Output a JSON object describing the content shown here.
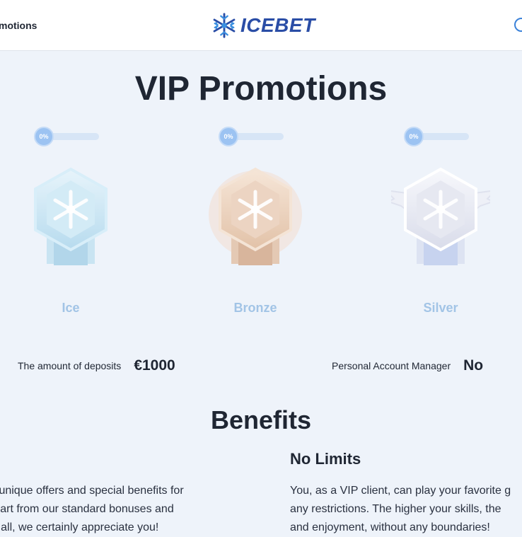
{
  "header": {
    "nav_label": "motions",
    "logo_text": "ICEBET"
  },
  "page": {
    "title": "VIP Promotions"
  },
  "tiers": [
    {
      "name": "Ice",
      "progress_label": "0%",
      "progress": 0,
      "color": "#a2c4e6"
    },
    {
      "name": "Bronze",
      "progress_label": "0%",
      "progress": 0,
      "color": "#a2c4e6"
    },
    {
      "name": "Silver",
      "progress_label": "0%",
      "progress": 0,
      "color": "#a2c4e6"
    }
  ],
  "stats": {
    "deposits_label": "The amount of deposits",
    "deposits_value": "€1000",
    "manager_label": "Personal Account Manager",
    "manager_value": "No"
  },
  "benefits": {
    "title": "Benefits",
    "items": [
      {
        "title": "",
        "lines": [
          "ys unique offers and special benefits for",
          " apart from our standard bonuses and",
          "ter all, we certainly appreciate you!"
        ]
      },
      {
        "title": "No Limits",
        "lines": [
          "You, as a VIP client, can play your favorite g",
          "any restrictions. The higher your skills, the",
          "and enjoyment, without any boundaries!"
        ]
      }
    ]
  },
  "colors": {
    "accent": "#3b82d9",
    "brand": "#2a4da6",
    "background": "#eef3fa",
    "text": "#1f2633"
  },
  "icons": {
    "logo": "snowflake-logo-icon",
    "header_right": "circle-icon",
    "badge_ice": "ice-snowflake-badge-icon",
    "badge_bronze": "bronze-snowflake-badge-icon",
    "badge_silver": "silver-winged-snowflake-badge-icon"
  }
}
